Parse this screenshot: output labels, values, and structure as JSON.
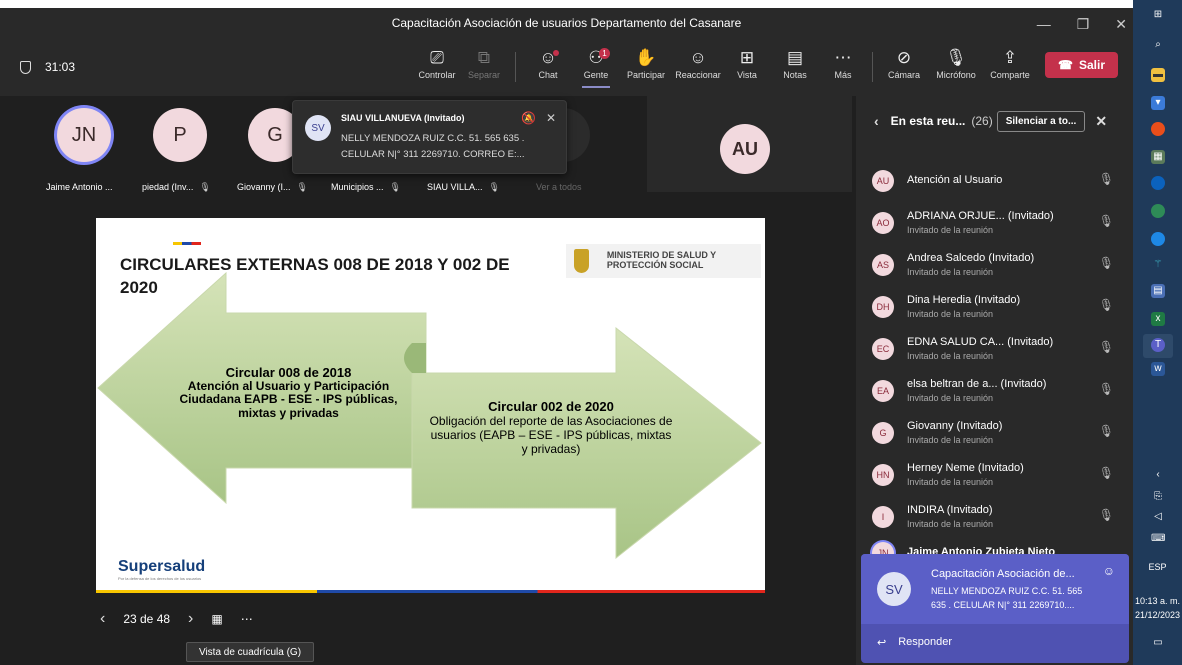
{
  "window": {
    "title": "Capacitación Asociación de usuarios Departamento del Casanare",
    "controls": [
      "—",
      "❐",
      "✕"
    ]
  },
  "toolbar": {
    "timer": "31:03",
    "buttons": [
      {
        "label": "Controlar",
        "icon": "control-icon"
      },
      {
        "label": "Separar",
        "icon": "pop-out-icon"
      },
      {
        "label": "Chat",
        "icon": "chat-icon"
      },
      {
        "label": "Gente",
        "icon": "people-icon",
        "badge": "1"
      },
      {
        "label": "Participar",
        "icon": "raise-hand-icon"
      },
      {
        "label": "Reaccionar",
        "icon": "react-icon"
      },
      {
        "label": "Vista",
        "icon": "view-icon"
      },
      {
        "label": "Notas",
        "icon": "notes-icon"
      },
      {
        "label": "Más",
        "icon": "more-icon"
      },
      {
        "label": "Cámara",
        "icon": "camera-off-icon"
      },
      {
        "label": "Micrófono",
        "icon": "mic-off-icon"
      },
      {
        "label": "Comparte",
        "icon": "share-icon"
      }
    ],
    "leave_label": "Salir"
  },
  "gallery": {
    "tiles": [
      {
        "initials": "JN",
        "label": "Jaime Antonio ...",
        "color": "#f2d9de"
      },
      {
        "initials": "P",
        "label": "piedad (Inv...",
        "color": "#f2d9de"
      },
      {
        "initials": "G",
        "label": "Giovanny (I...",
        "color": "#f2d9de"
      },
      {
        "label": "Municipios ..."
      },
      {
        "label": "SIAU VILLA..."
      }
    ],
    "see_all": "Ver a todos",
    "featured_initials": "AU"
  },
  "toast": {
    "initials": "SV",
    "sender": "SIAU VILLANUEVA (Invitado)",
    "line1": "NELLY MENDOZA RUIZ C.C. 51. 565 635 .",
    "line2": "CELULAR N|° 311 2269710.  CORREO E:..."
  },
  "slide": {
    "title": "CIRCULARES EXTERNAS 008 DE 2018 Y 002 DE 2020",
    "ministry": "MINISTERIO DE SALUD Y PROTECCIÓN SOCIAL",
    "circular1_title": "Circular 008 de 2018",
    "circular1_body": "Atención al Usuario y Participación Ciudadana  EAPB - ESE - IPS públicas, mixtas y privadas",
    "circular2_title": "Circular 002 de 2020",
    "circular2_body": "Obligación del reporte de las Asociaciones de usuarios  (EAPB – ESE - IPS públicas, mixtas y privadas)",
    "logo": "Supersalud",
    "logo_tagline": "Por la defensa de los derechos de los usuarios"
  },
  "slide_nav": {
    "page": "23 de 48",
    "tooltip": "Vista de cuadrícula (G)"
  },
  "panel": {
    "title": "En esta reu...",
    "count": "(26)",
    "mute_all": "Silenciar a to...",
    "participants": [
      {
        "initials": "AU",
        "name": "Atención al Usuario",
        "sub": ""
      },
      {
        "initials": "AO",
        "name": "ADRIANA ORJUE... (Invitado)",
        "sub": "Invitado de la reunión"
      },
      {
        "initials": "AS",
        "name": "Andrea Salcedo (Invitado)",
        "sub": "Invitado de la reunión"
      },
      {
        "initials": "DH",
        "name": "Dina Heredia (Invitado)",
        "sub": "Invitado de la reunión"
      },
      {
        "initials": "EC",
        "name": "EDNA SALUD CA... (Invitado)",
        "sub": "Invitado de la reunión"
      },
      {
        "initials": "EA",
        "name": "elsa beltran de a...  (Invitado)",
        "sub": "Invitado de la reunión"
      },
      {
        "initials": "G",
        "name": "Giovanny (Invitado)",
        "sub": "Invitado de la reunión"
      },
      {
        "initials": "HN",
        "name": "Herney Neme (Invitado)",
        "sub": "Invitado de la reunión"
      },
      {
        "initials": "I",
        "name": "INDIRA (Invitado)",
        "sub": "Invitado de la reunión"
      },
      {
        "initials": "JN",
        "name": "Jaime Antonio Zubieta Nieto",
        "sub": ""
      }
    ]
  },
  "chat_popup": {
    "initials": "SV",
    "title": "Capacitación Asociación de...",
    "line1": "NELLY MENDOZA RUIZ C.C. 51. 565",
    "line2": "635 . CELULAR N|° 311 2269710....",
    "reply": "Responder"
  },
  "taskbar": {
    "lang": "ESP",
    "time": "10:13 a. m.",
    "date": "21/12/2023"
  }
}
